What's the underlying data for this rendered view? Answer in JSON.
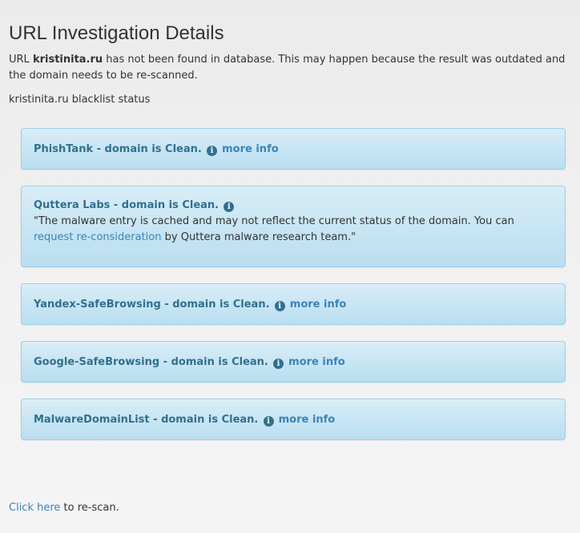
{
  "page": {
    "title": "URL Investigation Details",
    "intro_prefix": "URL ",
    "domain": "kristinita.ru",
    "intro_suffix": " has not been found in database. This may happen because the result was outdated and the domain needs to be re-scanned.",
    "status_label": "kristinita.ru blacklist status"
  },
  "results": [
    {
      "source": "PhishTank - domain is Clean.",
      "link": "more info"
    },
    {
      "source": "Quttera Labs - domain is Clean.",
      "quote_before": "\"The malware entry is cached and may not reflect the current status of the domain. You can ",
      "quote_link": "request re-consideration",
      "quote_after": " by Quttera malware research team.\""
    },
    {
      "source": "Yandex-SafeBrowsing - domain is Clean.",
      "link": "more info"
    },
    {
      "source": "Google-SafeBrowsing - domain is Clean.",
      "link": "more info"
    },
    {
      "source": "MalwareDomainList - domain is Clean.",
      "link": "more info"
    }
  ],
  "footer": {
    "rescan_link": "Click here",
    "rescan_suffix": " to re-scan."
  },
  "icons": {
    "info": "info-circle-icon"
  },
  "colors": {
    "alert_text": "#31708f",
    "link": "#3a84b8",
    "alert_border": "#9acfea"
  }
}
